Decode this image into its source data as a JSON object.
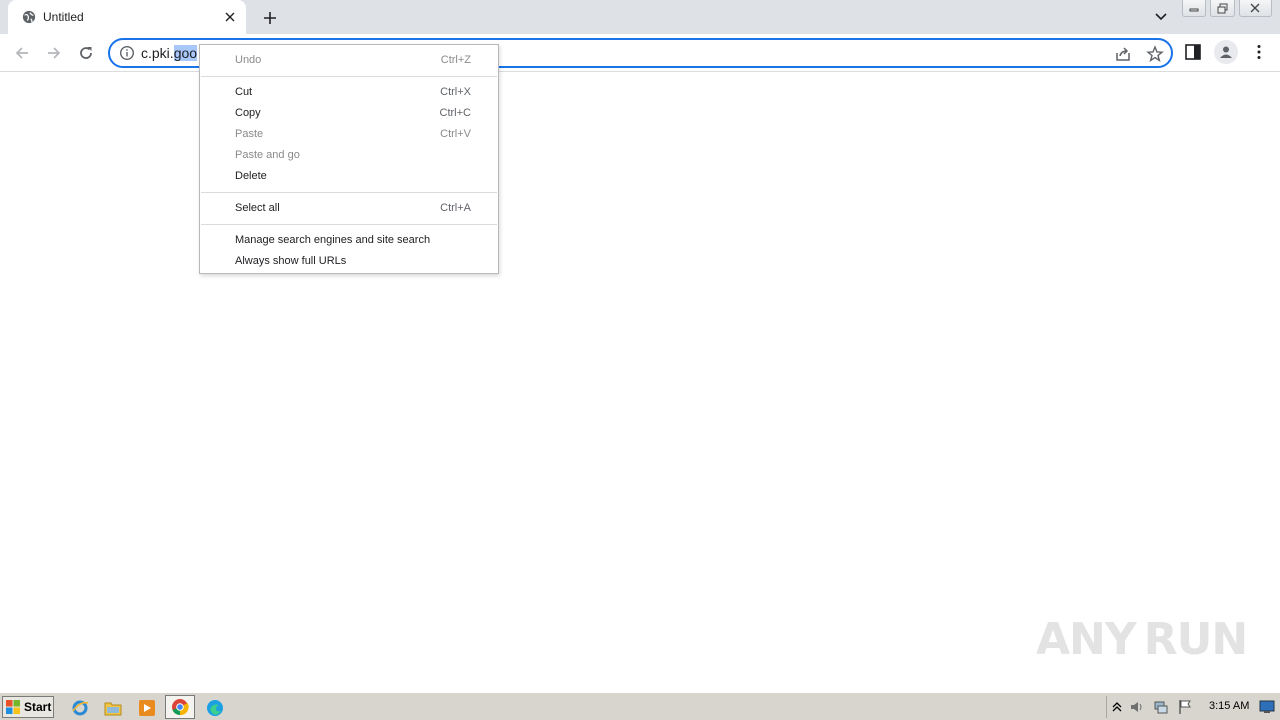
{
  "tab": {
    "title": "Untitled"
  },
  "omnibox": {
    "url_prefix": "c.pki.",
    "url_selected": "goo"
  },
  "context_menu": {
    "groups": [
      [
        {
          "label": "Undo",
          "shortcut": "Ctrl+Z",
          "enabled": false
        }
      ],
      [
        {
          "label": "Cut",
          "shortcut": "Ctrl+X",
          "enabled": true
        },
        {
          "label": "Copy",
          "shortcut": "Ctrl+C",
          "enabled": true
        },
        {
          "label": "Paste",
          "shortcut": "Ctrl+V",
          "enabled": false
        },
        {
          "label": "Paste and go",
          "shortcut": "",
          "enabled": false
        },
        {
          "label": "Delete",
          "shortcut": "",
          "enabled": true
        }
      ],
      [
        {
          "label": "Select all",
          "shortcut": "Ctrl+A",
          "enabled": true
        }
      ],
      [
        {
          "label": "Manage search engines and site search",
          "shortcut": "",
          "enabled": true
        },
        {
          "label": "Always show full URLs",
          "shortcut": "",
          "enabled": true
        }
      ]
    ]
  },
  "watermark": {
    "left": "ANY",
    "right": "RUN"
  },
  "taskbar": {
    "start_label": "Start",
    "clock": "3:15 AM"
  },
  "colors": {
    "accent": "#1a73e8",
    "tabstrip": "#dee1e6",
    "selection": "#a8c7fa",
    "taskbar": "#d7d5ce"
  }
}
